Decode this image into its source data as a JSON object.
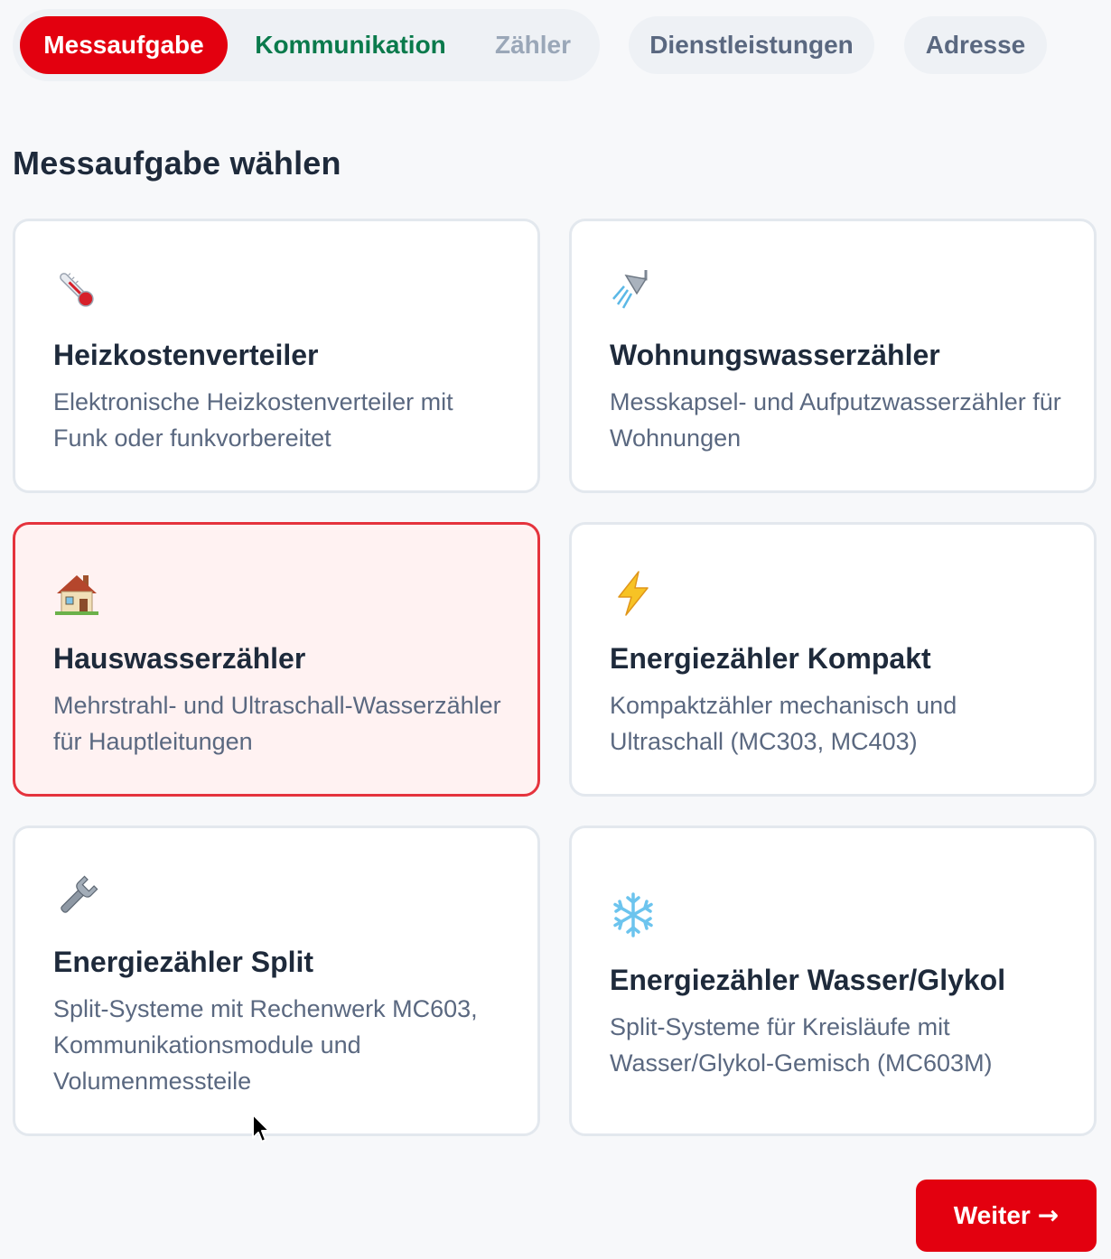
{
  "tabs": {
    "active": "Messaufgabe",
    "done": "Kommunikation",
    "upcoming": "Zähler",
    "services": "Dienstleistungen",
    "address": "Adresse"
  },
  "section_title": "Messaufgabe wählen",
  "cards": [
    {
      "title": "Heizkostenverteiler",
      "desc": "Elektronische Heizkostenverteiler mit Funk oder funkvorbereitet",
      "icon": "thermometer-icon"
    },
    {
      "title": "Wohnungswasserzähler",
      "desc": "Messkapsel- und Aufputzwasserzähler für Wohnungen",
      "icon": "shower-icon"
    },
    {
      "title": "Hauswasserzähler",
      "desc": "Mehrstrahl- und Ultraschall-Wasserzähler für Hauptleitungen",
      "icon": "house-icon",
      "selected": true
    },
    {
      "title": "Energiezähler Kompakt",
      "desc": "Kompaktzähler mechanisch und Ultraschall (MC303, MC403)",
      "icon": "lightning-icon"
    },
    {
      "title": "Energiezähler Split",
      "desc": "Split-Systeme mit Rechenwerk MC603, Kommunikationsmodule und Volumenmessteile",
      "icon": "wrench-icon"
    },
    {
      "title": "Energiezähler Wasser/Glykol",
      "desc": "Split-Systeme für Kreisläufe mit Wasser/Glykol-Gemisch (MC603M)",
      "icon": "snowflake-icon"
    }
  ],
  "next_button": {
    "label": "Weiter",
    "arrow": "→"
  },
  "colors": {
    "brand_red": "#e3000f",
    "done_green": "#0a7a4c",
    "selected_border": "#e5333d",
    "selected_bg": "#fff2f2"
  }
}
